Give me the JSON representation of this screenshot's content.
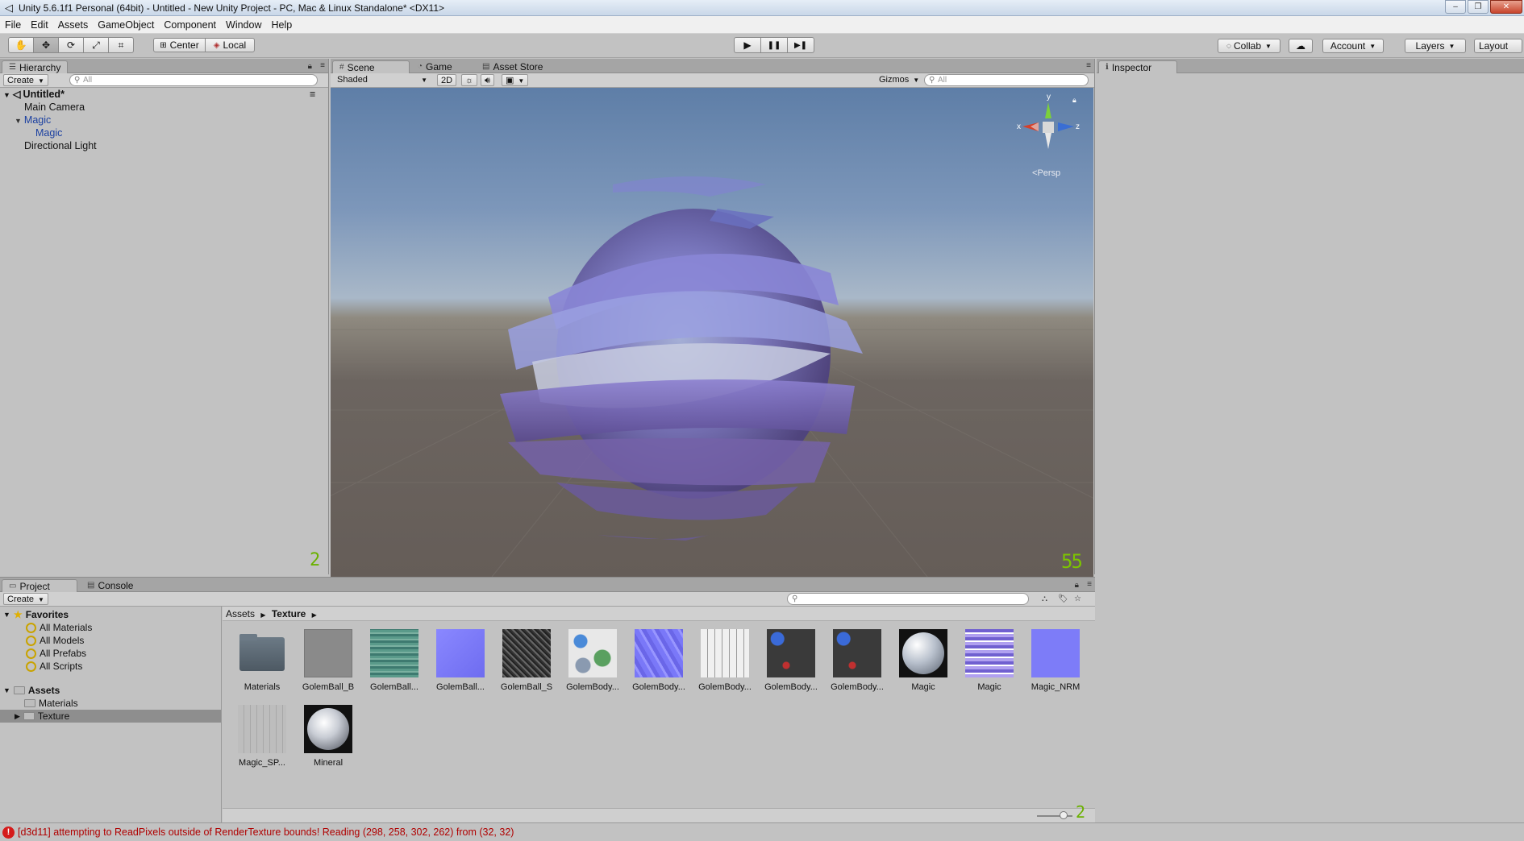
{
  "window": {
    "title": "Unity 5.6.1f1 Personal (64bit) - Untitled - New Unity Project - PC, Mac & Linux Standalone* <DX11>",
    "controls": [
      "–",
      "❐",
      "✕"
    ]
  },
  "menu": [
    "File",
    "Edit",
    "Assets",
    "GameObject",
    "Component",
    "Window",
    "Help"
  ],
  "toolbar": {
    "tools": [
      {
        "name": "hand-tool",
        "icon": "✋"
      },
      {
        "name": "move-tool",
        "icon": "✥"
      },
      {
        "name": "rotate-tool",
        "icon": "⟳"
      },
      {
        "name": "scale-tool",
        "icon": "⤢"
      },
      {
        "name": "rect-tool",
        "icon": "⌗"
      }
    ],
    "active_tool": "move-tool",
    "pivot_label": "Center",
    "space_label": "Local",
    "play_icons": [
      "▶",
      "❚❚",
      "▶❚"
    ],
    "collab_label": "Collab",
    "account_label": "Account",
    "layers_label": "Layers",
    "layout_label": "Layout"
  },
  "hierarchy": {
    "tab_label": "Hierarchy",
    "create_label": "Create",
    "search_placeholder": "All",
    "scene_name": "Untitled*",
    "items": [
      {
        "label": "Main Camera",
        "color": "#111111",
        "level": 0
      },
      {
        "label": "Magic",
        "color": "#1a3fa0",
        "level": 0,
        "expanded": true
      },
      {
        "label": "Magic",
        "color": "#1a3fa0",
        "level": 1
      },
      {
        "label": "Directional Light",
        "color": "#111111",
        "level": 0
      }
    ],
    "corner_number": "2"
  },
  "scene": {
    "tabs": [
      "Scene",
      "Game",
      "Asset Store"
    ],
    "active_tab": "Scene",
    "shading_mode": "Shaded",
    "mode_2d": "2D",
    "gizmos_label": "Gizmos",
    "search_placeholder": "All",
    "gizmo_axes": {
      "y": "y",
      "x": "x",
      "z": "z"
    },
    "projection_label": "Persp",
    "fps_badge": "55",
    "sky_color": "#6a88ae",
    "ground_color": "#6a625d"
  },
  "inspector": {
    "tab_label": "Inspector"
  },
  "project": {
    "tabs": [
      "Project",
      "Console"
    ],
    "active_tab": "Project",
    "create_label": "Create",
    "favorites": {
      "label": "Favorites",
      "items": [
        "All Materials",
        "All Models",
        "All Prefabs",
        "All Scripts"
      ]
    },
    "assets_root": {
      "label": "Assets",
      "items": [
        {
          "label": "Materials",
          "selected": false
        },
        {
          "label": "Texture",
          "selected": true
        }
      ]
    },
    "breadcrumb": [
      "Assets",
      "Texture"
    ],
    "assets": [
      {
        "label": "Materials",
        "kind": "folder"
      },
      {
        "label": "GolemBall_B",
        "kind": "gray"
      },
      {
        "label": "GolemBall...",
        "kind": "teal-noise"
      },
      {
        "label": "GolemBall...",
        "kind": "normal"
      },
      {
        "label": "GolemBall_S",
        "kind": "dark-noise"
      },
      {
        "label": "GolemBody...",
        "kind": "atlas-color"
      },
      {
        "label": "GolemBody...",
        "kind": "normal-blocks"
      },
      {
        "label": "GolemBody...",
        "kind": "atlas-white"
      },
      {
        "label": "GolemBody...",
        "kind": "dark-spot"
      },
      {
        "label": "GolemBody...",
        "kind": "dark-spot"
      },
      {
        "label": "Magic",
        "kind": "sphere"
      },
      {
        "label": "Magic",
        "kind": "magic-tex"
      },
      {
        "label": "Magic_NRM",
        "kind": "normal"
      },
      {
        "label": "Magic_SP...",
        "kind": "light-gray"
      },
      {
        "label": "Mineral",
        "kind": "sphere-dark"
      }
    ],
    "corner_number": "2"
  },
  "status": {
    "icon": "!",
    "message": "[d3d11] attempting to ReadPixels outside of RenderTexture bounds! Reading (298, 258, 302, 262) from (32, 32)"
  }
}
